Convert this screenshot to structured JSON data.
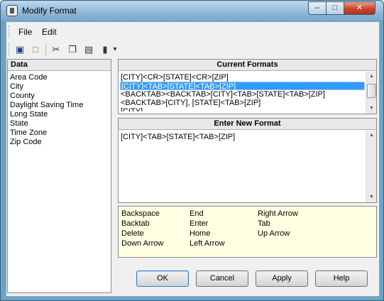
{
  "window": {
    "title": "Modify Format"
  },
  "menu": [
    "File",
    "Edit"
  ],
  "toolbar": [
    {
      "icon": "save-icon",
      "glyph": "▣"
    },
    {
      "icon": "new-document-icon",
      "glyph": "□"
    },
    {
      "icon": "cut-icon",
      "glyph": "✂"
    },
    {
      "icon": "copy-icon",
      "glyph": "❐"
    },
    {
      "icon": "paste-icon",
      "glyph": "▤"
    },
    {
      "icon": "delete-icon",
      "glyph": "▮"
    },
    {
      "icon": "dropdown-arrow-icon",
      "glyph": "▾"
    }
  ],
  "data_panel": {
    "header": "Data",
    "items": [
      "Area Code",
      "City",
      "County",
      "Daylight Saving Time",
      "Long State",
      "State",
      "Time Zone",
      "Zip Code"
    ]
  },
  "current_formats": {
    "header": "Current Formats",
    "items": [
      "[CITY]<CR>[STATE]<CR>[ZIP]",
      "[CITY]<TAB>[STATE]<TAB>[ZIP]",
      "<BACKTAB><BACKTAB>[CITY]<TAB>[STATE]<TAB>[ZIP]",
      "<BACKTAB>[CITY], [STATE]<TAB>[ZIP]",
      "[CITY]"
    ],
    "selected_index": 1
  },
  "new_format": {
    "header": "Enter New Format",
    "value": "[CITY]<TAB>[STATE]<TAB>[ZIP]"
  },
  "keys": [
    [
      "Backspace",
      "Backtab",
      "Delete",
      "Down Arrow"
    ],
    [
      "End",
      "Enter",
      "Home",
      "Left Arrow"
    ],
    [
      "Right Arrow",
      "Tab",
      "Up Arrow"
    ]
  ],
  "buttons": {
    "ok": "OK",
    "cancel": "Cancel",
    "apply": "Apply",
    "help": "Help"
  },
  "title_buttons": {
    "minimize": "–",
    "maximize": "□",
    "close": "✕"
  },
  "colors": {
    "selection": "#3399ff",
    "keys_background": "#ffffe1"
  }
}
